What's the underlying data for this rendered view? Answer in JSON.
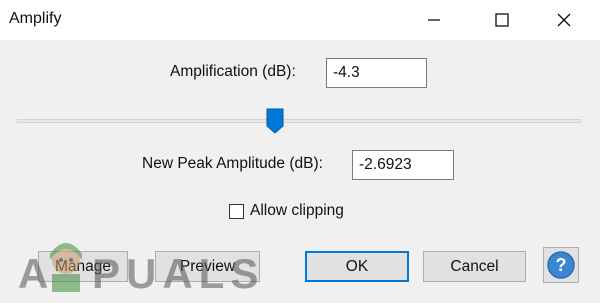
{
  "window": {
    "title": "Amplify",
    "controls": [
      "minimize-icon",
      "maximize-icon",
      "close-icon"
    ]
  },
  "amplification": {
    "label": "Amplification (dB):",
    "value": "-4.3"
  },
  "slider": {
    "value_db": -4.3
  },
  "peak": {
    "label": "New Peak Amplitude (dB):",
    "value": "-2.6923"
  },
  "clipping": {
    "label": "Allow clipping",
    "checked": false
  },
  "buttons": {
    "manage": "Manage",
    "preview": "Preview",
    "ok": "OK",
    "cancel": "Cancel",
    "help_icon": "help-icon"
  },
  "watermark": {
    "text": "APPUALS"
  },
  "colors": {
    "accent": "#0078d7",
    "help": "#3a86d0",
    "window_bg": "#f0f0f0"
  }
}
